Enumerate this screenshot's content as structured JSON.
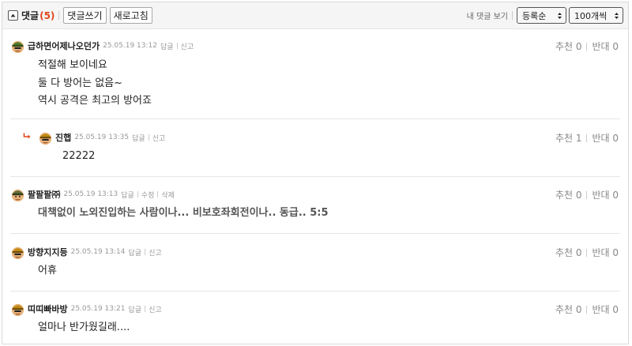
{
  "toolbar": {
    "title": "댓글",
    "count": "(5)",
    "write_label": "댓글쓰기",
    "refresh_label": "새로고침",
    "my_comments_label": "내 댓글 보기",
    "sort_value": "등록순",
    "per_page_value": "100개씩"
  },
  "comments": [
    {
      "nick": "급하면어제나오던가",
      "date": "25.05.19 13:12",
      "actions": [
        "답글",
        "신고"
      ],
      "vote": {
        "up": "추천 0",
        "down": "반대 0"
      },
      "lines": [
        "적절해 보이네요",
        "둘 다 방어는 없음~",
        "역시 공격은 최고의 방어죠"
      ]
    },
    {
      "nick": "진햅",
      "date": "25.05.19 13:35",
      "actions": [
        "답글",
        "신고"
      ],
      "vote": {
        "up": "추천 1",
        "down": "반대 0"
      },
      "lines": [
        "22222"
      ]
    },
    {
      "nick": "팔팔팔㈜",
      "date": "25.05.19 13:13",
      "actions": [
        "답글",
        "수정",
        "삭제"
      ],
      "vote": {
        "up": "추천 0",
        "down": "반대 0"
      },
      "lines": [
        "대책없이 노외진입하는 사람이나... 비보호좌회전이나.. 동급.. 5:5"
      ]
    },
    {
      "nick": "방향지지등",
      "date": "25.05.19 13:14",
      "actions": [
        "답글",
        "신고"
      ],
      "vote": {
        "up": "추천 0",
        "down": "반대 0"
      },
      "lines": [
        "어휴"
      ]
    },
    {
      "nick": "띠띠빠바방",
      "date": "25.05.19 13:21",
      "actions": [
        "답글",
        "신고"
      ],
      "vote": {
        "up": "추천 0",
        "down": "반대 0"
      },
      "lines": [
        "얼마나 반가웠길래...."
      ]
    }
  ],
  "colors": {
    "count": "#e2461e",
    "reply_arrow": "#e2461e",
    "divider": "#e6e6e6",
    "toolbar_bg": "#f5f5f5"
  },
  "icons": {
    "toggle": "collapse-toggle-icon",
    "reply": "reply-arrow-icon",
    "avatar": "helmet-avatar-icon"
  }
}
